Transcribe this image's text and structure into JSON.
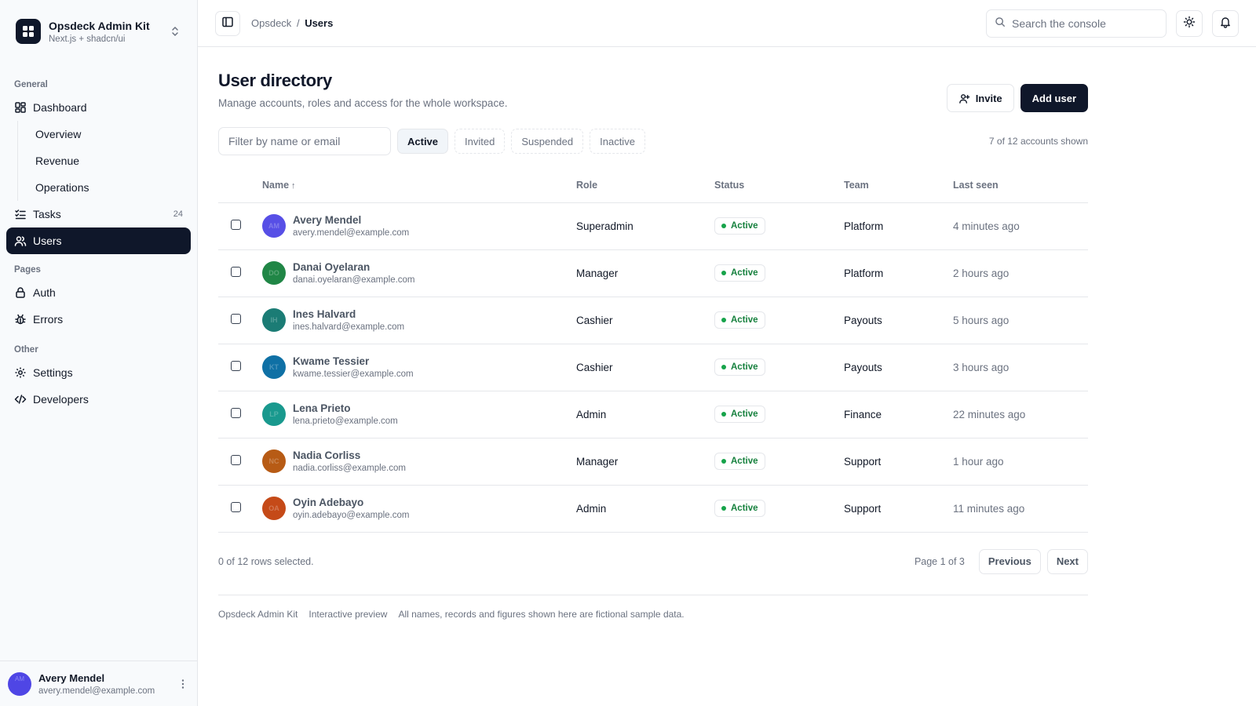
{
  "brand": {
    "name": "Opsdeck Admin Kit",
    "subtitle": "Next.js + shadcn/ui"
  },
  "sidebar": {
    "sections": {
      "general": "General",
      "pages": "Pages",
      "other": "Other"
    },
    "dashboard": {
      "label": "Dashboard",
      "icon": "dashboard-icon"
    },
    "subitems": [
      "Overview",
      "Revenue",
      "Operations"
    ],
    "tasks": {
      "label": "Tasks",
      "count": "24",
      "icon": "tasks-icon"
    },
    "users": {
      "label": "Users",
      "icon": "users-icon"
    },
    "auth": {
      "label": "Auth",
      "icon": "lock-icon"
    },
    "errors": {
      "label": "Errors",
      "icon": "bug-icon"
    },
    "settings": {
      "label": "Settings",
      "icon": "gear-icon"
    },
    "developers": {
      "label": "Developers",
      "icon": "code-icon"
    },
    "footer": {
      "name": "Avery Mendel",
      "email": "avery.mendel@example.com",
      "initials": "AM"
    }
  },
  "topbar": {
    "breadcrumb_root": "Opsdeck",
    "breadcrumb_sep": "/",
    "breadcrumb_current": "Users",
    "search_placeholder": "Search the console"
  },
  "page": {
    "title": "User directory",
    "description": "Manage accounts, roles and access for the whole workspace.",
    "invite_label": "Invite",
    "add_user_label": "Add user"
  },
  "filters": {
    "placeholder": "Filter by name or email",
    "chips": [
      "Active",
      "Invited",
      "Suspended",
      "Inactive"
    ],
    "active_chip": "Active",
    "shown_text": "7 of 12 accounts shown"
  },
  "table": {
    "columns": {
      "name": "Name",
      "role": "Role",
      "status": "Status",
      "team": "Team",
      "last_seen": "Last seen"
    },
    "rows": [
      {
        "initials": "AM",
        "name": "Avery Mendel",
        "email": "avery.mendel@example.com",
        "role": "Superadmin",
        "status": "Active",
        "team": "Platform",
        "last_seen": "4 minutes ago",
        "avatar_color": "#4f46e5"
      },
      {
        "initials": "DO",
        "name": "Danai Oyelaran",
        "email": "danai.oyelaran@example.com",
        "role": "Manager",
        "status": "Active",
        "team": "Platform",
        "last_seen": "2 hours ago",
        "avatar_color": "#15803d"
      },
      {
        "initials": "IH",
        "name": "Ines Halvard",
        "email": "ines.halvard@example.com",
        "role": "Cashier",
        "status": "Active",
        "team": "Payouts",
        "last_seen": "5 hours ago",
        "avatar_color": "#0f766e"
      },
      {
        "initials": "KT",
        "name": "Kwame Tessier",
        "email": "kwame.tessier@example.com",
        "role": "Cashier",
        "status": "Active",
        "team": "Payouts",
        "last_seen": "3 hours ago",
        "avatar_color": "#0369a1"
      },
      {
        "initials": "LP",
        "name": "Lena Prieto",
        "email": "lena.prieto@example.com",
        "role": "Admin",
        "status": "Active",
        "team": "Finance",
        "last_seen": "22 minutes ago",
        "avatar_color": "#0d9488"
      },
      {
        "initials": "NC",
        "name": "Nadia Corliss",
        "email": "nadia.corliss@example.com",
        "role": "Manager",
        "status": "Active",
        "team": "Support",
        "last_seen": "1 hour ago",
        "avatar_color": "#b45309"
      },
      {
        "initials": "OA",
        "name": "Oyin Adebayo",
        "email": "oyin.adebayo@example.com",
        "role": "Admin",
        "status": "Active",
        "team": "Support",
        "last_seen": "11 minutes ago",
        "avatar_color": "#c2410c"
      }
    ]
  },
  "pagination": {
    "selected_text": "0 of 12 rows selected.",
    "page_text": "Page 1 of 3",
    "previous_label": "Previous",
    "next_label": "Next"
  },
  "footer": {
    "items": [
      "Opsdeck Admin Kit",
      "Interactive preview",
      "All names, records and figures shown here are fictional sample data."
    ]
  },
  "colors": {
    "primary": "#0f172a",
    "success": "#16a34a",
    "border": "#e5e7eb",
    "muted": "#6b7280"
  }
}
